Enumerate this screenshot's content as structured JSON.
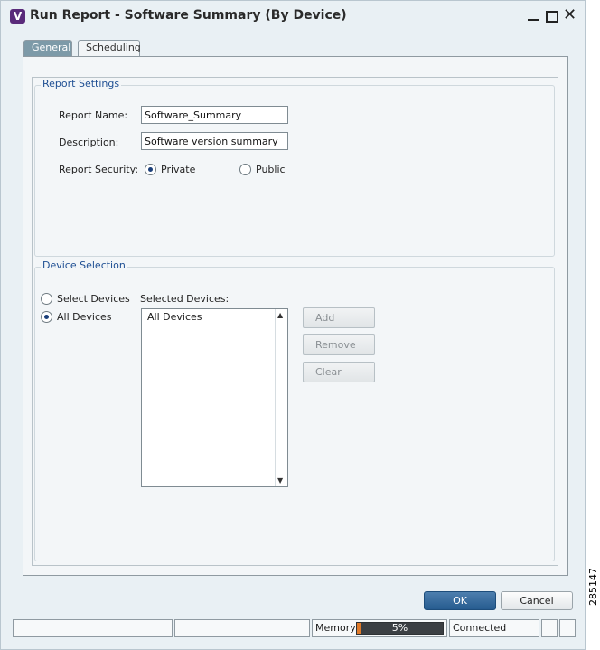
{
  "window": {
    "title": "Run Report - Software Summary (By Device)",
    "logo_letter": "V"
  },
  "tabs": [
    {
      "label": "General",
      "selected": true
    },
    {
      "label": "Scheduling",
      "selected": false
    }
  ],
  "report_settings": {
    "group_label": "Report Settings",
    "name_label": "Report Name:",
    "name_value": "Software_Summary",
    "description_label": "Description:",
    "description_value": "Software version summary",
    "security_label": "Report Security:",
    "security_options": [
      {
        "label": "Private",
        "checked": true
      },
      {
        "label": "Public",
        "checked": false
      }
    ]
  },
  "device_selection": {
    "group_label": "Device Selection",
    "options": [
      {
        "label": "Select Devices",
        "checked": false
      },
      {
        "label": "All Devices",
        "checked": true
      }
    ],
    "selected_label": "Selected Devices:",
    "selected_items": [
      "All Devices"
    ],
    "buttons": {
      "add": "Add",
      "remove": "Remove",
      "clear": "Clear"
    }
  },
  "dialog_buttons": {
    "ok": "OK",
    "cancel": "Cancel"
  },
  "status_bar": {
    "memory_label": "Memory:",
    "memory_percent": 5,
    "memory_text": "5%",
    "connection": "Connected"
  },
  "side_id": "285147",
  "colors": {
    "accent": "#265b8f",
    "group_label": "#1f4f93",
    "memory_fill": "#e07a2a"
  }
}
